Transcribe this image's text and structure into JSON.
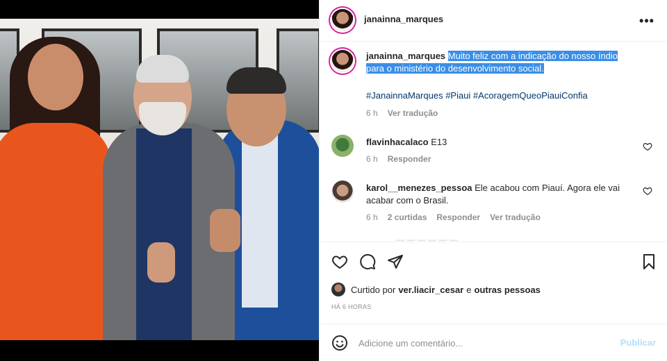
{
  "header": {
    "username": "janainna_marques",
    "more_icon": "more-horizontal-icon"
  },
  "caption": {
    "username": "janainna_marques",
    "text_line1": "Muito feliz com a indicação do nosso índio",
    "text_line2": "para o ministério do desenvolvimento social.",
    "hashtags": "#JanainnaMarques #Piaui #AcoragemQueoPiauiConfia",
    "time": "6 h",
    "translate": "Ver tradução"
  },
  "comments": [
    {
      "username": "flavinhacalaco",
      "text": "E13",
      "time": "6 h",
      "reply": "Responder"
    },
    {
      "username": "karol__menezes_pessoa",
      "text_line1": "Ele acabou com Piauí. Agora ele vai",
      "text_line2": "acabar com o Brasil.",
      "time": "6 h",
      "likes": "2 curtidas",
      "reply": "Responder",
      "translate": "Ver tradução"
    }
  ],
  "actions": {
    "like_icon": "heart-icon",
    "comment_icon": "comment-icon",
    "share_icon": "send-icon",
    "save_icon": "bookmark-icon"
  },
  "likes": {
    "prefix": "Curtido por",
    "user": "ver.liacir_cesar",
    "connector": "e",
    "others": "outras pessoas"
  },
  "timestamp": "HÁ 6 HORAS",
  "add_comment": {
    "placeholder": "Adicione um comentário...",
    "publish": "Publicar",
    "emoji_icon": "smiley-icon"
  },
  "colors": {
    "link": "#00376b",
    "selection": "#3a8ee6",
    "publish_disabled": "#b2dffc",
    "muted": "#8e8e8e"
  }
}
